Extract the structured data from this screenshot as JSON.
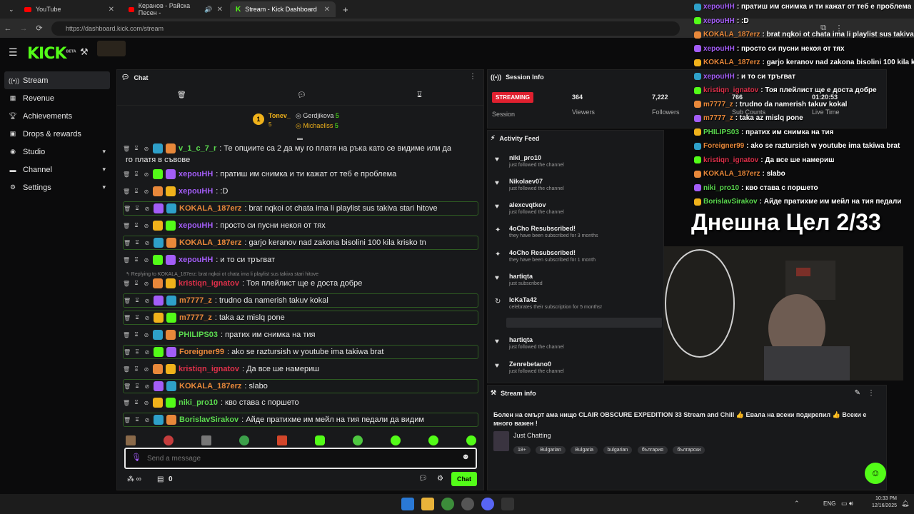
{
  "browser": {
    "tabs": [
      {
        "label": "YouTube"
      },
      {
        "label": "Керанов - Райска Песен -"
      },
      {
        "label": "Stream - Kick Dashboard"
      }
    ],
    "url": "https://dashboard.kick.com/stream"
  },
  "header": {
    "logo": "KICK",
    "beta": "BETA"
  },
  "sidebar": {
    "items": [
      {
        "label": "Stream"
      },
      {
        "label": "Revenue"
      },
      {
        "label": "Achievements"
      },
      {
        "label": "Drops & rewards"
      },
      {
        "label": "Studio"
      },
      {
        "label": "Channel"
      },
      {
        "label": "Settings"
      }
    ]
  },
  "chat": {
    "title": "Chat",
    "pinned": {
      "first": {
        "name": "Tonev_",
        "count": "5",
        "rank": "1"
      },
      "second": {
        "name": "Gerdjikova",
        "count": "5"
      },
      "third": {
        "name": "Michaellss",
        "count": "5"
      }
    },
    "messages": [
      {
        "user": "v_1_c_7_r",
        "text": ": Те опциите са 2 да му го платя на ръка като се видиме или да",
        "cont": "го платя в съвове",
        "color": "#5bd94f"
      },
      {
        "user": "xepouHH",
        "text": ": пратиш им снимка и ти кажат от теб е проблема",
        "color": "#a35df7"
      },
      {
        "user": "xepouHH",
        "text": ": :D",
        "color": "#a35df7"
      },
      {
        "user": "KOKALA_187erz",
        "text": ": brat nqkoi ot chata ima li playlist sus takiva stari hitove",
        "color": "#e8883a"
      },
      {
        "user": "xepouHH",
        "text": ": просто си пусни некоя от тях",
        "color": "#a35df7"
      },
      {
        "user": "KOKALA_187erz",
        "text": ": garjo keranov nad zakona bisolini 100 kila krisko tn",
        "color": "#e8883a"
      },
      {
        "user": "xepouHH",
        "text": ": и то си тръгват",
        "color": "#a35df7"
      },
      {
        "user": "kristiqn_ignatov",
        "text": ": Тоя плейлист ще е доста добре",
        "color": "#e0304a"
      },
      {
        "user": "m7777_z",
        "text": ": trudno da namerish takuv kokal",
        "color": "#e8883a"
      },
      {
        "user": "m7777_z",
        "text": ": taka az mislq pone",
        "color": "#e8883a"
      },
      {
        "user": "PHILIPS03",
        "text": ": пратих им снимка на тия",
        "color": "#5bd94f"
      },
      {
        "user": "Foreigner99",
        "text": ": ako se raztursish w youtube ima takiwa brat",
        "color": "#e8883a"
      },
      {
        "user": "kristiqn_ignatov",
        "text": ": Да все ше намериш",
        "color": "#e0304a"
      },
      {
        "user": "KOKALA_187erz",
        "text": ": slabo",
        "color": "#e8883a"
      },
      {
        "user": "niki_pro10",
        "text": ": кво става с поршето",
        "color": "#5bd94f"
      },
      {
        "user": "BorislavSirakov",
        "text": ": Айде пратихме им мейл на тия педали да видим",
        "color": "#5bd94f"
      }
    ],
    "reply_note": "Replying to KOKALA_187erz: brat nqkoi ot chata ima li playlist sus takiva stari hitove",
    "input_placeholder": "Send a message",
    "send_label": "Chat",
    "counter": "0"
  },
  "session": {
    "title": "Session Info",
    "status": "STREAMING",
    "status_label": "Session",
    "viewers": "364",
    "viewers_label": "Viewers",
    "followers": "7,222",
    "followers_label": "Followers",
    "subs": "766",
    "subs_label": "Sub Counts",
    "live": "01:20:53",
    "live_label": "Live Time"
  },
  "activity": {
    "title": "Activity Feed",
    "filter": "Filter",
    "items": [
      {
        "name": "niki_pro10",
        "sub": "just followed the channel"
      },
      {
        "name": "Nikolaev07",
        "sub": "just followed the channel"
      },
      {
        "name": "alexcvqtkov",
        "sub": "just followed the channel"
      },
      {
        "name": "4oCho Resubscribed!",
        "sub": "they have been subscribed for 3 months"
      },
      {
        "name": "4oCho Resubscribed!",
        "sub": "they have been subscribed for 1 month"
      },
      {
        "name": "hartiqta",
        "sub": "just subscribed"
      },
      {
        "name": "IcKaTa42",
        "sub": "celebrates their subscription for 5 months!"
      },
      {
        "name": "hartiqta",
        "sub": "just followed the channel"
      },
      {
        "name": "Zenrebetano0",
        "sub": "just followed the channel"
      }
    ],
    "time1": "11 minutes ago",
    "time2": "6 minutes ago"
  },
  "streaminfo": {
    "title": "Stream info",
    "stream_title": "Болен на смърт ама нищо CLAIR OBSCURE EXPEDITION 33 Stream and Chill 👍 Евала на всеки подкрепил 👍 Всеки е много важен !",
    "category": "Just Chatting",
    "tags": [
      "18+",
      "Bulgarian",
      "Bulgaria",
      "bulgarian",
      "българия",
      "български"
    ]
  },
  "overlay": {
    "lines": [
      {
        "user": "xepouHH",
        "text": ": пратиш им снимка и ти кажат от теб е проблема",
        "color": "#a35df7"
      },
      {
        "user": "xepouHH",
        "text": ": :D",
        "color": "#a35df7"
      },
      {
        "user": "KOKALA_187erz",
        "text": ": brat nqkoi ot chata ima li playlist sus takiva stari hitove",
        "color": "#e8883a"
      },
      {
        "user": "xepouHH",
        "text": ": просто си пусни некоя от тях",
        "color": "#a35df7"
      },
      {
        "user": "KOKALA_187erz",
        "text": ": garjo keranov nad zakona bisolini 100 kila krisko tn",
        "color": "#e8883a"
      },
      {
        "user": "xepouHH",
        "text": ": и то си тръгват",
        "color": "#a35df7"
      },
      {
        "user": "kristiqn_ignatov",
        "text": ": Тоя плейлист ще е доста добре",
        "color": "#e0304a"
      },
      {
        "user": "m7777_z",
        "text": ": trudno da namerish takuv kokal",
        "color": "#e8883a"
      },
      {
        "user": "m7777_z",
        "text": ": taka az mislq pone",
        "color": "#e8883a"
      },
      {
        "user": "PHILIPS03",
        "text": ": пратих им снимка на тия",
        "color": "#5bd94f"
      },
      {
        "user": "Foreigner99",
        "text": ": ako se raztursish w youtube ima takiwa brat",
        "color": "#e8883a"
      },
      {
        "user": "kristiqn_ignatov",
        "text": ": Да все ше намериш",
        "color": "#e0304a"
      },
      {
        "user": "KOKALA_187erz",
        "text": ": slabo",
        "color": "#e8883a"
      },
      {
        "user": "niki_pro10",
        "text": ": кво става с поршето",
        "color": "#5bd94f"
      },
      {
        "user": "BorislavSirakov",
        "text": ": Айде пратихме им мейл на тия педали",
        "color": "#5bd94f"
      }
    ],
    "goal": "Днешна Цел 2/33"
  },
  "taskbar": {
    "lang": "ENG",
    "time": "10:33 PM",
    "date": "12/16/2025"
  },
  "colors": {
    "accent": "#53fc18",
    "live": "#e0202f"
  }
}
